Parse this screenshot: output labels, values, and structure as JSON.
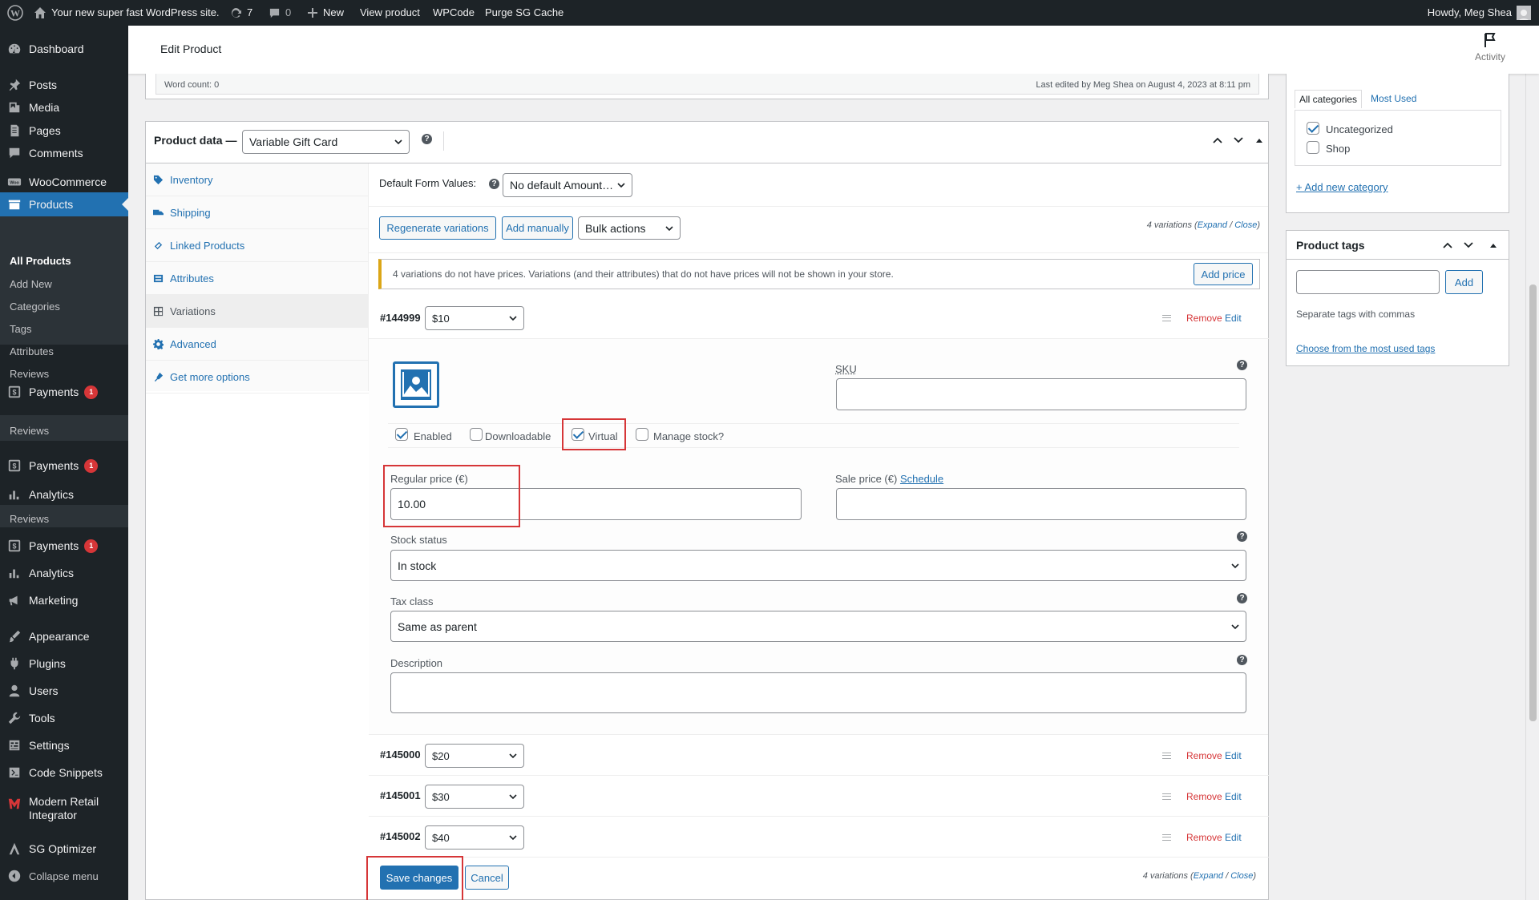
{
  "adminbar": {
    "site_name": "Your new super fast WordPress site.",
    "updates_count": "7",
    "comments_count": "0",
    "new_label": "New",
    "view_product": "View product",
    "wpcode": "WPCode",
    "purge": "Purge SG Cache",
    "howdy": "Howdy, Meg Shea"
  },
  "sidebar": {
    "dashboard": "Dashboard",
    "posts": "Posts",
    "media": "Media",
    "pages": "Pages",
    "comments": "Comments",
    "woocommerce": "WooCommerce",
    "products": "Products",
    "sub": [
      "All Products",
      "Add New",
      "Categories",
      "Tags",
      "Attributes",
      "Reviews"
    ],
    "payments": "Payments",
    "payments_badge": "1",
    "reviews": "Reviews",
    "payments2": "Payments",
    "analytics": "Analytics",
    "reviews2": "Reviews",
    "payments3": "Payments",
    "analytics2": "Analytics",
    "marketing": "Marketing",
    "appearance": "Appearance",
    "plugins": "Plugins",
    "users": "Users",
    "tools": "Tools",
    "settings": "Settings",
    "code_snippets": "Code Snippets",
    "modern_retail_1": "Modern Retail",
    "modern_retail_2": "Integrator",
    "sg_optimizer": "SG Optimizer",
    "collapse": "Collapse menu"
  },
  "header": {
    "title": "Edit Product",
    "activity": "Activity"
  },
  "editor_status": {
    "word_count": "Word count: 0",
    "last_edited": "Last edited by Meg Shea on August 4, 2023 at 8:11 pm"
  },
  "product_data": {
    "label": "Product data —",
    "type": "Variable Gift Card",
    "help": "?",
    "tabs": [
      "Inventory",
      "Shipping",
      "Linked Products",
      "Attributes",
      "Variations",
      "Advanced",
      "Get more options"
    ],
    "default_form_label": "Default Form Values:",
    "default_form_value": "No default Amount…",
    "regenerate": "Regenerate variations",
    "add_manually": "Add manually",
    "bulk_actions": "Bulk actions",
    "variations_count": "4 variations",
    "expand": "Expand",
    "slash": "/",
    "close": "Close",
    "notice": "4 variations do not have prices. Variations (and their attributes) that do not have prices will not be shown in your store.",
    "add_price": "Add price",
    "remove": "Remove",
    "edit": "Edit",
    "save_changes": "Save changes",
    "cancel": "Cancel"
  },
  "variation_1": {
    "id": "#144999",
    "amount": "$10",
    "sku_label": "SKU",
    "sku_value": "",
    "enabled": "Enabled",
    "downloadable": "Downloadable",
    "virtual": "Virtual",
    "manage_stock": "Manage stock?",
    "regular_price_label": "Regular price (€)",
    "regular_price": "10.00",
    "sale_price_label": "Sale price (€)",
    "schedule": "Schedule",
    "stock_status_label": "Stock status",
    "stock_status": "In stock",
    "tax_class_label": "Tax class",
    "tax_class": "Same as parent",
    "description_label": "Description"
  },
  "other_variations": [
    {
      "id": "#145000",
      "amount": "$20"
    },
    {
      "id": "#145001",
      "amount": "$30"
    },
    {
      "id": "#145002",
      "amount": "$40"
    }
  ],
  "categories": {
    "tab_all": "All categories",
    "tab_most_used": "Most Used",
    "items": [
      "Uncategorized",
      "Shop"
    ],
    "add_new": "+ Add new category"
  },
  "product_tags": {
    "title": "Product tags",
    "add": "Add",
    "hint": "Separate tags with commas",
    "choose": "Choose from the most used tags"
  },
  "colors": {
    "accent": "#2271b1",
    "sidebar": "#1d2327",
    "highlight_red": "#d63638"
  }
}
